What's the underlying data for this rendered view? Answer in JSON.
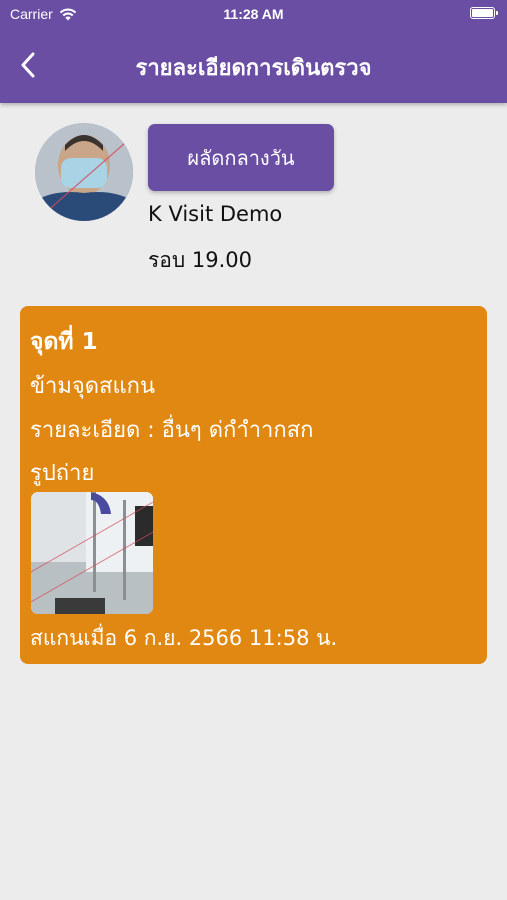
{
  "status_bar": {
    "carrier": "Carrier",
    "time": "11:28 AM"
  },
  "nav": {
    "title": "รายละเอียดการเดินตรวจ",
    "back_icon": "chevron-left-icon"
  },
  "profile": {
    "shift_label": "ผลัดกลางวัน",
    "name": "K Visit Demo",
    "round": "รอบ 19.00"
  },
  "checkpoint": {
    "title": "จุดที่ 1",
    "skip_text": "ข้ามจุดสแกน",
    "detail_text": "รายละเอียด : อื่นๆ ด่กำำากสก",
    "photo_label": "รูปถ่าย",
    "scanned_text": "สแกนเมื่อ  6 ก.ย. 2566 11:58 น."
  },
  "colors": {
    "header": "#6a4ea3",
    "card": "#e08811",
    "background": "#ececec"
  }
}
